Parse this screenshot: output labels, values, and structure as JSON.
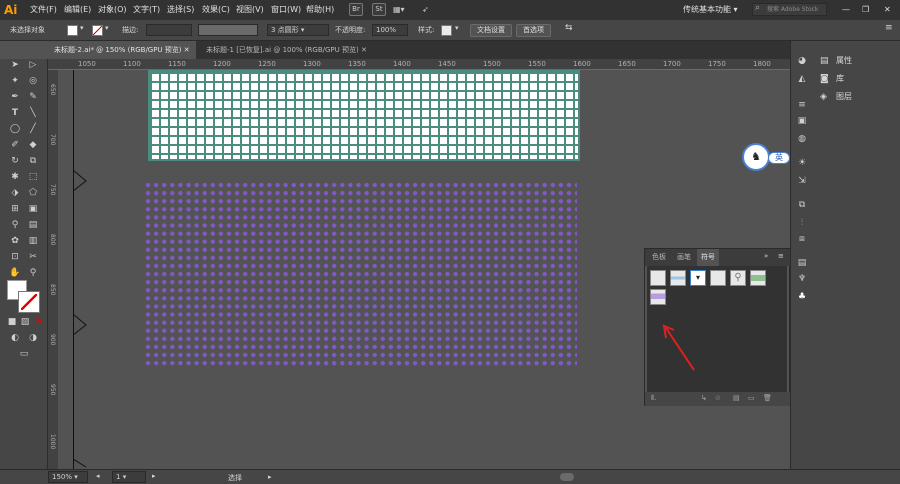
{
  "menubar": {
    "logo": "Ai",
    "items": [
      "文件(F)",
      "编辑(E)",
      "对象(O)",
      "文字(T)",
      "选择(S)",
      "效果(C)",
      "视图(V)",
      "窗口(W)",
      "帮助(H)"
    ],
    "icons": [
      "Br",
      "St"
    ],
    "workspace": "传统基本功能",
    "search_placeholder": "搜索 Adobe Stock"
  },
  "controlbar": {
    "selection_label": "未选择对象",
    "stroke_label": "描边:",
    "points_label": "3 点圆形",
    "opacity_label": "不透明度:",
    "opacity_value": "100%",
    "style_label": "样式:",
    "doc_setup": "文档设置",
    "prefs": "首选项"
  },
  "tabs": [
    {
      "label": "未标题-2.ai* @ 150% (RGB/GPU 预览)",
      "active": true
    },
    {
      "label": "未标题-1 [已恢复].ai @ 100% (RGB/GPU 预览)",
      "active": false
    }
  ],
  "ruler_top": [
    "1050",
    "1100",
    "1150",
    "1200",
    "1250",
    "1300",
    "1350",
    "1400",
    "1450",
    "1500",
    "1550",
    "1600",
    "1650",
    "1700",
    "1750",
    "1800"
  ],
  "ruler_left": [
    "650",
    "700",
    "750",
    "800",
    "850",
    "900",
    "950",
    "1000"
  ],
  "status": {
    "zoom": "150%",
    "page": "1",
    "tool": "选择"
  },
  "right_panel": {
    "items": [
      "属性",
      "库",
      "图层"
    ]
  },
  "symbols_panel": {
    "tabs": [
      "色板",
      "画笔",
      "符号"
    ],
    "active_tab": "符号"
  },
  "ime": {
    "label": "英"
  },
  "colors": {
    "grid_stroke": "#4b8b80",
    "dot_fill": "#8159c6",
    "accent_arrow": "#e02020",
    "app_orange": "#ff9a00"
  }
}
